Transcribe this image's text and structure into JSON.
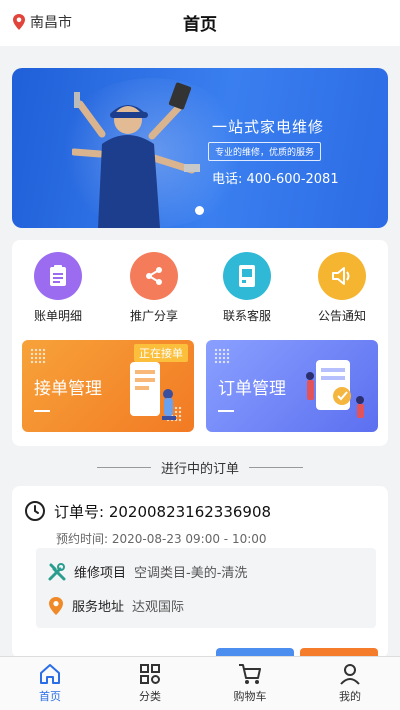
{
  "header": {
    "city": "南昌市",
    "title": "首页"
  },
  "banner": {
    "headline": "一站式家电维修",
    "subtitle": "专业的维修，优质的服务",
    "phone": "电话: 400-600-2081"
  },
  "quick_actions": [
    {
      "label": "账单明细",
      "icon": "bill-icon",
      "color": "#9b6cf0"
    },
    {
      "label": "推广分享",
      "icon": "share-icon",
      "color": "#f47c5a"
    },
    {
      "label": "联系客服",
      "icon": "contact-icon",
      "color": "#2fb9d6"
    },
    {
      "label": "公告通知",
      "icon": "announcement-icon",
      "color": "#f6b531"
    }
  ],
  "management": [
    {
      "title": "接单管理",
      "badge": "正在接单",
      "color": "#f4892b"
    },
    {
      "title": "订单管理",
      "color": "#6a7ff5"
    }
  ],
  "section": {
    "title": "进行中的订单"
  },
  "order": {
    "number": "订单号: 20200823162336908",
    "time": "预约时间: 2020-08-23 09:00 - 10:00",
    "item_key": "维修项目",
    "item_value": "空调类目-美的-清洗",
    "address_key": "服务地址",
    "address_value": "达观国际"
  },
  "tabbar": [
    {
      "label": "首页",
      "icon": "home-icon",
      "active": true
    },
    {
      "label": "分类",
      "icon": "category-icon"
    },
    {
      "label": "购物车",
      "icon": "cart-icon"
    },
    {
      "label": "我的",
      "icon": "profile-icon"
    }
  ]
}
